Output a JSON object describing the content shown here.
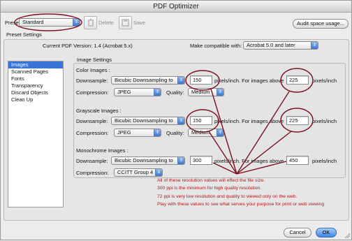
{
  "window": {
    "title": "PDF Optimizer"
  },
  "toolbar": {
    "preset_label": "Preset:",
    "preset_value": "Standard",
    "delete_label": "Delete",
    "save_label": "Save",
    "audit_label": "Audit space usage..."
  },
  "preset_settings": {
    "section_label": "Preset Settings",
    "current_version_label": "Current PDF Version: 1.4 (Acrobat 5.x)",
    "compat_label": "Make compatible with:",
    "compat_value": "Acrobat 5.0 and later"
  },
  "sidebar": {
    "items": [
      {
        "label": "Images",
        "selected": true
      },
      {
        "label": "Scanned Pages",
        "selected": false
      },
      {
        "label": "Fonts",
        "selected": false
      },
      {
        "label": "Transparency",
        "selected": false
      },
      {
        "label": "Discard Objects",
        "selected": false
      },
      {
        "label": "Clean Up",
        "selected": false
      }
    ]
  },
  "image_settings": {
    "group_label": "Image Settings",
    "color": {
      "heading": "Color Images :",
      "downsample_label": "Downsample:",
      "downsample_value": "Bicubic Downsampling to",
      "ppi_value": "150",
      "mid_label": "pixels/inch. For images above",
      "above_value": "225",
      "end_label": "pixels/inch",
      "compression_label": "Compression:",
      "compression_value": "JPEG",
      "quality_label": "Quality:",
      "quality_value": "Medium"
    },
    "grayscale": {
      "heading": "Grayscale Images :",
      "downsample_label": "Downsample:",
      "downsample_value": "Bicubic Downsampling to",
      "ppi_value": "150",
      "mid_label": "pixels/inch. For images above",
      "above_value": "225",
      "end_label": "pixels/inch",
      "compression_label": "Compression:",
      "compression_value": "JPEG",
      "quality_label": "Quality:",
      "quality_value": "Medium"
    },
    "monochrome": {
      "heading": "Monochrome Images :",
      "downsample_label": "Downsample:",
      "downsample_value": "Bicubic Downsampling to",
      "ppi_value": "300",
      "mid_label": "pixels/inch. For images above",
      "above_value": "450",
      "end_label": "pixels/inch",
      "compression_label": "Compression:",
      "compression_value": "CCITT Group 4"
    }
  },
  "annotation": {
    "lines": [
      "All of these resolution values will effect the  file size.",
      "300 ppi is the minimum for high quality resolution.",
      "72 ppi is very low resolution and quality to viewed only on the web.",
      "Play with these values to see what serves your purpose for print or web viewing"
    ],
    "color": "#b01818",
    "ellipse_color": "#7a1020"
  },
  "footer": {
    "cancel_label": "Cancel",
    "ok_label": "OK"
  },
  "colors": {
    "accent": "#3875d7"
  }
}
